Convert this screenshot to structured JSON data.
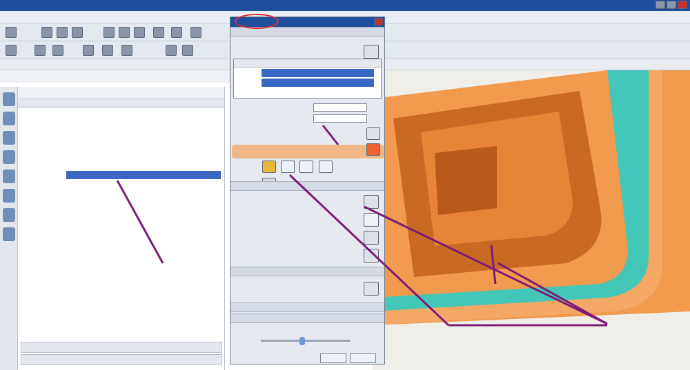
{
  "window": {
    "title": "",
    "brand": ""
  },
  "menu": [],
  "dialog": {
    "title": "",
    "ok": "",
    "cancel": "",
    "speed": ""
  },
  "navigator": {
    "title": "",
    "columns": [],
    "rows": []
  },
  "annotations": [],
  "watermark": ""
}
